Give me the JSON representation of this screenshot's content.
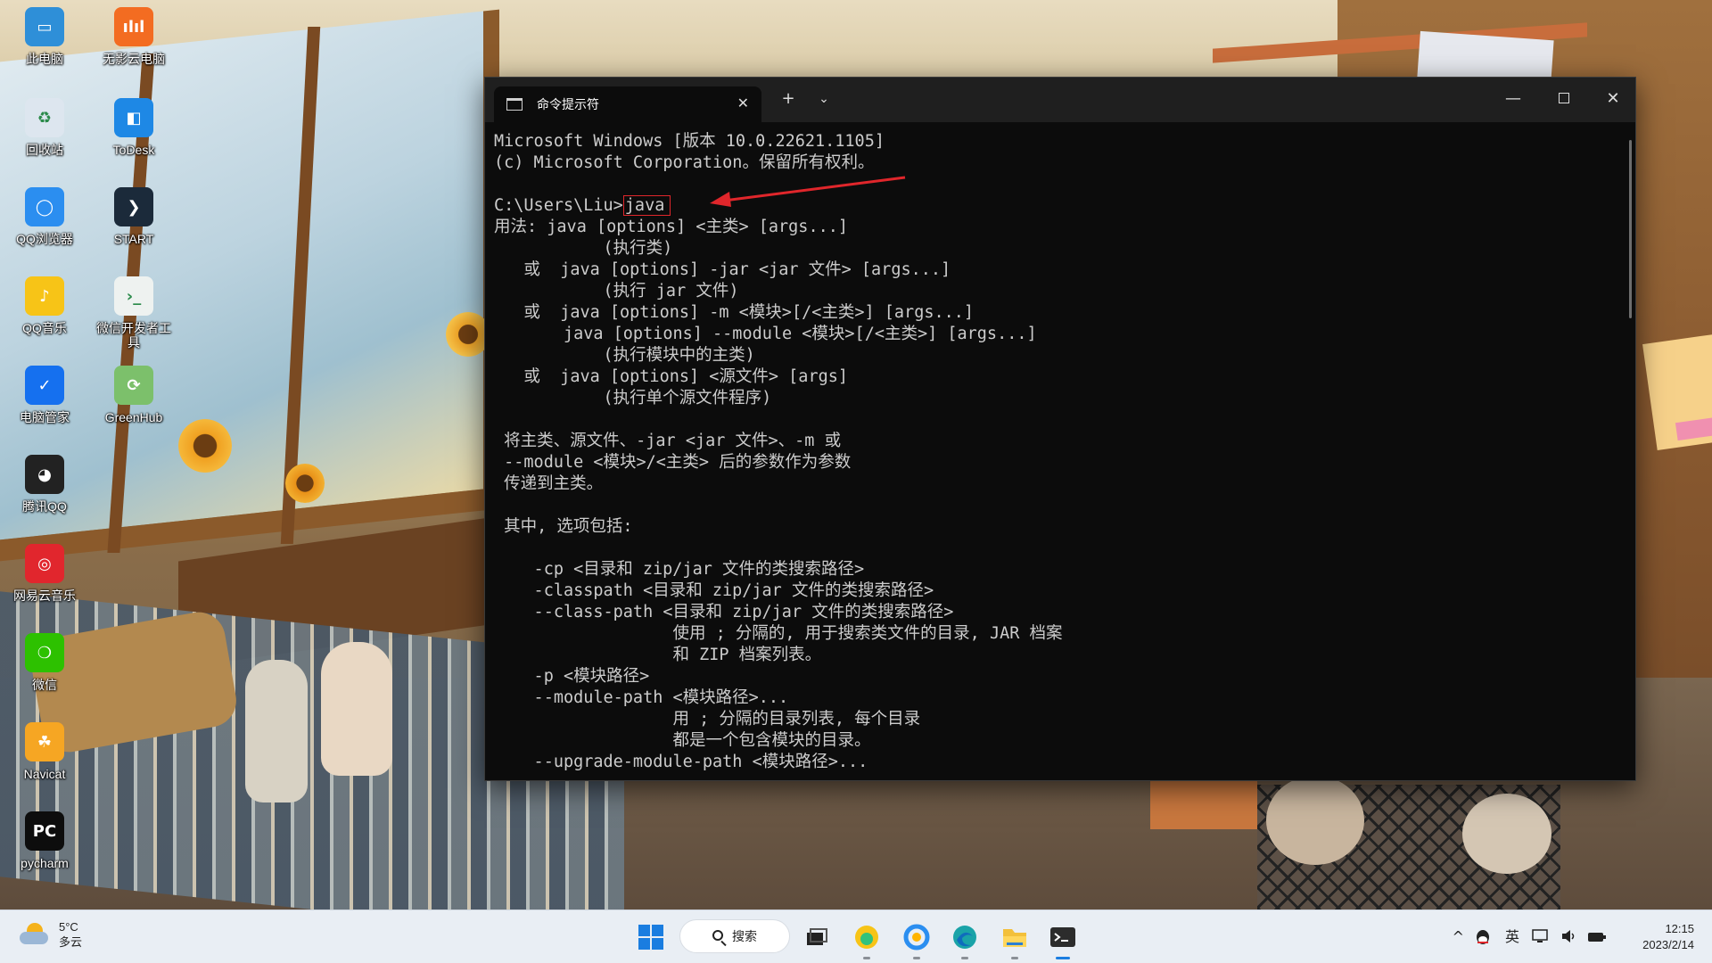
{
  "desktop": {
    "icons": [
      {
        "label": "此电脑",
        "glyph": "▭",
        "color": "#2e8fd8"
      },
      {
        "label": "无影云电脑",
        "glyph": "ılıl",
        "color": "#f36c21"
      },
      {
        "label": "回收站",
        "glyph": "♻",
        "color": "#dde6ef"
      },
      {
        "label": "ToDesk",
        "glyph": "◧",
        "color": "#1e88e5"
      },
      {
        "label": "QQ浏览器",
        "glyph": "◯",
        "color": "#2b8ef0"
      },
      {
        "label": "START",
        "glyph": "❯",
        "color": "#1b2a3a"
      },
      {
        "label": "QQ音乐",
        "glyph": "♪",
        "color": "#f7c417"
      },
      {
        "label": "微信开发者工具",
        "glyph": "›_",
        "color": "#eef2f0"
      },
      {
        "label": "电脑管家",
        "glyph": "✓",
        "color": "#1570ef"
      },
      {
        "label": "GreenHub",
        "glyph": "⟳",
        "color": "#7cc06b"
      },
      {
        "label": "腾讯QQ",
        "glyph": "◕",
        "color": "#222222"
      },
      {
        "label": "网易云音乐",
        "glyph": "◎",
        "color": "#e1262d"
      },
      {
        "label": "微信",
        "glyph": "❍",
        "color": "#2dc100"
      },
      {
        "label": "Navicat",
        "glyph": "☘",
        "color": "#f6a623"
      },
      {
        "label": "pycharm",
        "glyph": "PC",
        "color": "#0d0d0d"
      }
    ]
  },
  "terminal": {
    "tab_title": "命令提示符",
    "tab_close": "✕",
    "new_tab": "+",
    "tab_menu": "⌄",
    "minimize": "—",
    "close": "✕",
    "prompt": "C:\\Users\\Liu>",
    "command": "java",
    "lines": [
      "Microsoft Windows [版本 10.0.22621.1105]",
      "(c) Microsoft Corporation。保留所有权利。",
      "",
      "",
      "用法: java [options] <主类> [args...]",
      "           (执行类)",
      "   或  java [options] -jar <jar 文件> [args...]",
      "           (执行 jar 文件)",
      "   或  java [options] -m <模块>[/<主类>] [args...]",
      "       java [options] --module <模块>[/<主类>] [args...]",
      "           (执行模块中的主类)",
      "   或  java [options] <源文件> [args]",
      "           (执行单个源文件程序)",
      "",
      " 将主类、源文件、-jar <jar 文件>、-m 或",
      " --module <模块>/<主类> 后的参数作为参数",
      " 传递到主类。",
      "",
      " 其中, 选项包括:",
      "",
      "    -cp <目录和 zip/jar 文件的类搜索路径>",
      "    -classpath <目录和 zip/jar 文件的类搜索路径>",
      "    --class-path <目录和 zip/jar 文件的类搜索路径>",
      "                  使用 ; 分隔的, 用于搜索类文件的目录, JAR 档案",
      "                  和 ZIP 档案列表。",
      "    -p <模块路径>",
      "    --module-path <模块路径>...",
      "                  用 ; 分隔的目录列表, 每个目录",
      "                  都是一个包含模块的目录。",
      "    --upgrade-module-path <模块路径>..."
    ]
  },
  "taskbar": {
    "weather_temp": "5°C",
    "weather_desc": "多云",
    "search_label": "搜索",
    "tray_chevron": "^",
    "tray_ime": "英",
    "time": "12:15",
    "date": "2023/2/14"
  },
  "colors": {
    "terminal_bg": "#0c0c0c",
    "terminal_text": "#cccccc",
    "highlight_red": "#e0262b",
    "taskbar_bg": "#e9eef4"
  }
}
